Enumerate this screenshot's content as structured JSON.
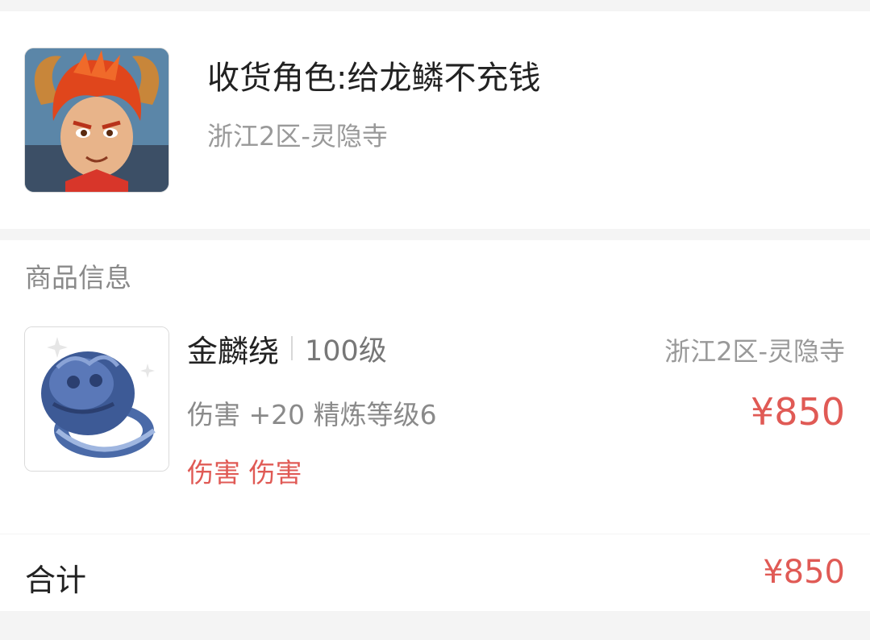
{
  "receiver": {
    "avatar_icon": "monkey-king-portrait-icon",
    "role": "收货角色:给龙鳞不充钱",
    "server": "浙江2区-灵隐寺"
  },
  "goods": {
    "section_title": "商品信息",
    "item": {
      "image_icon": "beast-ring-icon",
      "name": "金麟绕",
      "level": "100级",
      "server": "浙江2区-灵隐寺",
      "attributes": "伤害 +20 精炼等级6",
      "price": "¥850",
      "tags": "伤害 伤害"
    }
  },
  "total": {
    "label": "合计",
    "price": "¥850"
  },
  "colors": {
    "accent_price": "#e05a55",
    "background": "#f4f4f4",
    "card": "#ffffff"
  }
}
